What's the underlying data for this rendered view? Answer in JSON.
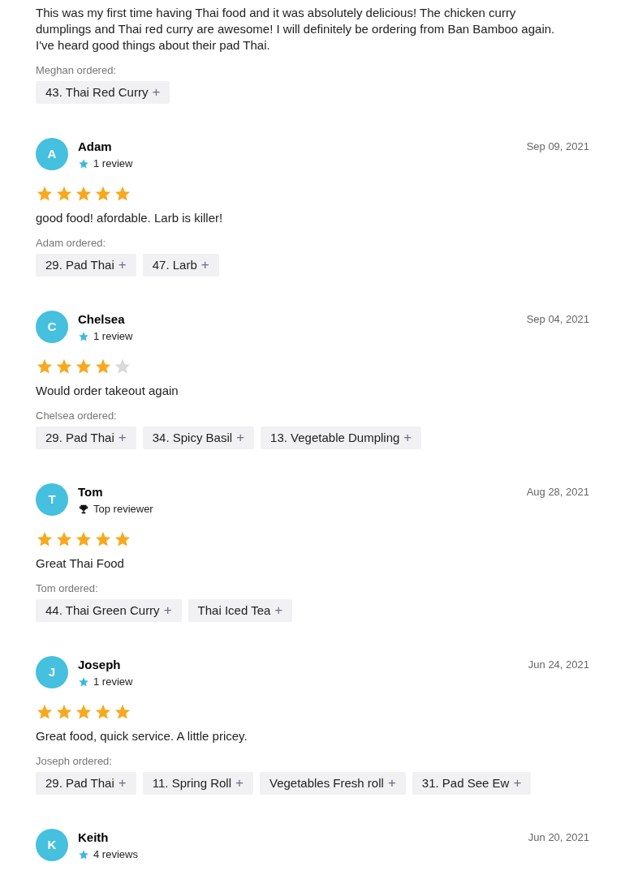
{
  "reviews": [
    {
      "text": "This was my first time having Thai food and it was absolutely delicious! The chicken curry dumplings and Thai red curry are awesome! I will definitely be ordering from Ban Bamboo again. I've heard good things about their pad Thai.",
      "ordered_label": "Meghan ordered:",
      "items": [
        {
          "name": "43. Thai Red Curry",
          "icon": "+"
        }
      ]
    },
    {
      "initial": "A",
      "name": "Adam",
      "badge": {
        "kind": "star",
        "text": "1 review"
      },
      "date": "Sep 09, 2021",
      "stars": 5,
      "text": "good food! afordable. Larb is killer!",
      "ordered_label": "Adam ordered:",
      "items": [
        {
          "name": "29. Pad Thai",
          "icon": "+"
        },
        {
          "name": "47. Larb",
          "icon": "+"
        }
      ]
    },
    {
      "initial": "C",
      "name": "Chelsea",
      "badge": {
        "kind": "star",
        "text": "1 review"
      },
      "date": "Sep 04, 2021",
      "stars": 4,
      "text": "Would order takeout again",
      "ordered_label": "Chelsea ordered:",
      "items": [
        {
          "name": "29. Pad Thai",
          "icon": "+"
        },
        {
          "name": "34. Spicy Basil",
          "icon": "+"
        },
        {
          "name": "13. Vegetable Dumpling",
          "icon": "+"
        }
      ]
    },
    {
      "initial": "T",
      "name": "Tom",
      "badge": {
        "kind": "trophy",
        "text": "Top reviewer"
      },
      "date": "Aug 28, 2021",
      "stars": 5,
      "text": "Great Thai Food",
      "ordered_label": "Tom ordered:",
      "items": [
        {
          "name": "44. Thai Green Curry",
          "icon": "+"
        },
        {
          "name": "Thai Iced Tea",
          "icon": "+"
        }
      ]
    },
    {
      "initial": "J",
      "name": "Joseph",
      "badge": {
        "kind": "star",
        "text": "1 review"
      },
      "date": "Jun 24, 2021",
      "stars": 5,
      "text": "Great food, quick service. A little pricey.",
      "ordered_label": "Joseph ordered:",
      "items": [
        {
          "name": "29. Pad Thai",
          "icon": "+"
        },
        {
          "name": "11. Spring Roll",
          "icon": "+"
        },
        {
          "name": "Vegetables Fresh roll",
          "icon": "+"
        },
        {
          "name": "31. Pad See Ew",
          "icon": "+"
        }
      ]
    },
    {
      "initial": "K",
      "name": "Keith",
      "badge": {
        "kind": "star",
        "text": "4 reviews"
      },
      "date": "Jun 20, 2021"
    }
  ]
}
